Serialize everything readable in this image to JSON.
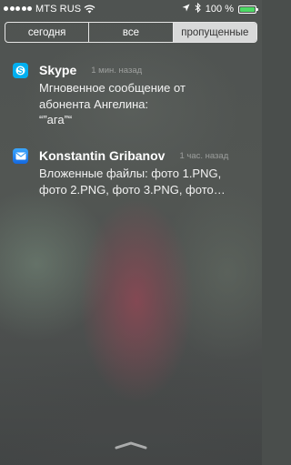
{
  "status_bar": {
    "carrier": "MTS RUS",
    "battery_percent": "100 %",
    "signal_dots": 5,
    "battery_color": "#4cd964"
  },
  "tabs": [
    {
      "label": "сегодня",
      "active": false
    },
    {
      "label": "все",
      "active": false
    },
    {
      "label": "пропущенные",
      "active": true
    }
  ],
  "notifications": [
    {
      "app": "Skype",
      "icon": "skype-icon",
      "icon_color": "#00aff0",
      "time": "1 мин. назад",
      "lines": [
        "Мгновенное сообщение от",
        "абонента Ангелина:",
        "“”ага”“"
      ]
    },
    {
      "app": "Konstantin Gribanov",
      "icon": "mail-icon",
      "icon_color": "#1e8cf0",
      "time": "1 час. назад",
      "lines": [
        "Вложенные файлы: фото 1.PNG,",
        "фото 2.PNG, фото 3.PNG, фото…"
      ]
    }
  ]
}
